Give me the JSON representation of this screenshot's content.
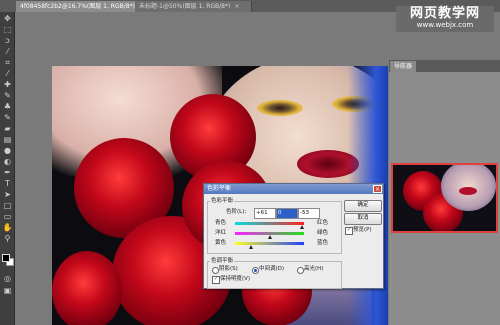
{
  "tabs": [
    {
      "label": "4f08458fc2b2@16.7%(图层 1, RGB/8*)",
      "close": "×",
      "active": true
    },
    {
      "label": "未标题-1@50%(图层 1, RGB/8*)",
      "close": "×",
      "active": false
    }
  ],
  "watermark": {
    "line1": "网页教学网",
    "line2": "www.webjx.com"
  },
  "navigator": {
    "tab_label": "导航器"
  },
  "dialog": {
    "title": "色彩平衡",
    "close": "×",
    "group_color_balance": "色彩平衡",
    "color_levels_label": "色阶(L):",
    "levels": [
      "+61",
      "0",
      "-53"
    ],
    "sliders": [
      {
        "left": "青色",
        "right": "红色",
        "value": 61
      },
      {
        "left": "洋红",
        "right": "绿色",
        "value": 0
      },
      {
        "left": "黄色",
        "right": "蓝色",
        "value": -53
      }
    ],
    "group_tone_balance": "色调平衡",
    "tones": [
      {
        "label": "阴影(S)",
        "selected": false
      },
      {
        "label": "中间调(D)",
        "selected": true
      },
      {
        "label": "高光(H)",
        "selected": false
      }
    ],
    "preserve_luminosity": "保持明度(V)",
    "preserve_checked": true,
    "ok_label": "确定",
    "cancel_label": "取消",
    "preview_label": "预览(P)",
    "preview_checked": true
  },
  "tools": [
    "move-tool",
    "marquee-tool",
    "lasso-tool",
    "magic-wand-tool",
    "crop-tool",
    "eyedropper-tool",
    "healing-brush-tool",
    "brush-tool",
    "clone-stamp-tool",
    "history-brush-tool",
    "eraser-tool",
    "gradient-tool",
    "blur-tool",
    "dodge-tool",
    "pen-tool",
    "type-tool",
    "path-selection-tool",
    "shape-tool",
    "notes-tool",
    "hand-tool",
    "zoom-tool"
  ]
}
